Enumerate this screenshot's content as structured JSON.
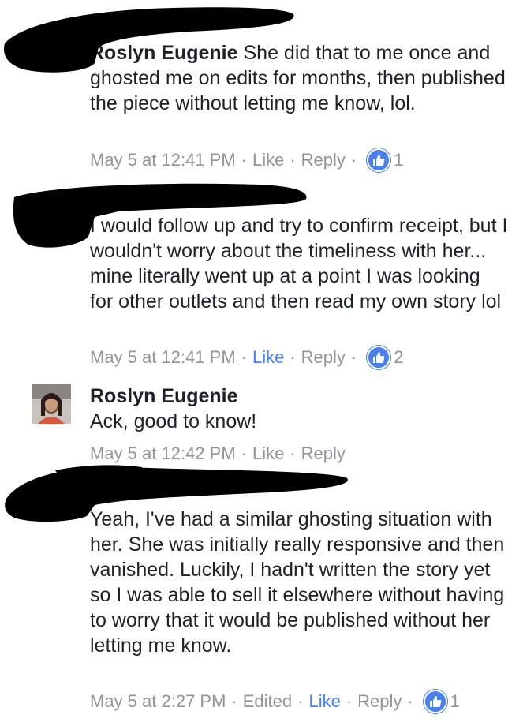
{
  "comments": [
    {
      "author": "Roslyn Eugenie",
      "text": "She did that to me once and ghosted me on edits for months, then published the piece without letting me know, lol.",
      "time": "May 5 at 12:41 PM",
      "like": "Like",
      "reply": "Reply",
      "reactions": "1"
    },
    {
      "author": "",
      "text": "I would follow up and try to confirm receipt, but I wouldn't worry about the timeliness with her... mine literally went up at a point I was looking for other outlets and then read my own story lol",
      "time": "May 5 at 12:41 PM",
      "like": "Like",
      "reply": "Reply",
      "reactions": "2"
    },
    {
      "author": "Roslyn Eugenie",
      "text": "Ack, good to know!",
      "time": "May 5 at 12:42 PM",
      "like": "Like",
      "reply": "Reply"
    },
    {
      "author": "",
      "text": "Yeah, I've had a similar ghosting situation with her. She was initially really responsive and then vanished. Luckily, I hadn't written the story yet so I was able to sell it elsewhere without having to worry that it would be published without her letting me know.",
      "time": "May 5 at 2:27 PM",
      "edited": "Edited",
      "like": "Like",
      "reply": "Reply",
      "reactions": "1"
    }
  ],
  "colors": {
    "text": "#1d2129",
    "meta": "#90949c",
    "liked": "#4080ff",
    "badge": "#4a7ff0",
    "redaction": "#000000"
  },
  "icons": [
    "thumbs-up-icon",
    "avatar"
  ]
}
